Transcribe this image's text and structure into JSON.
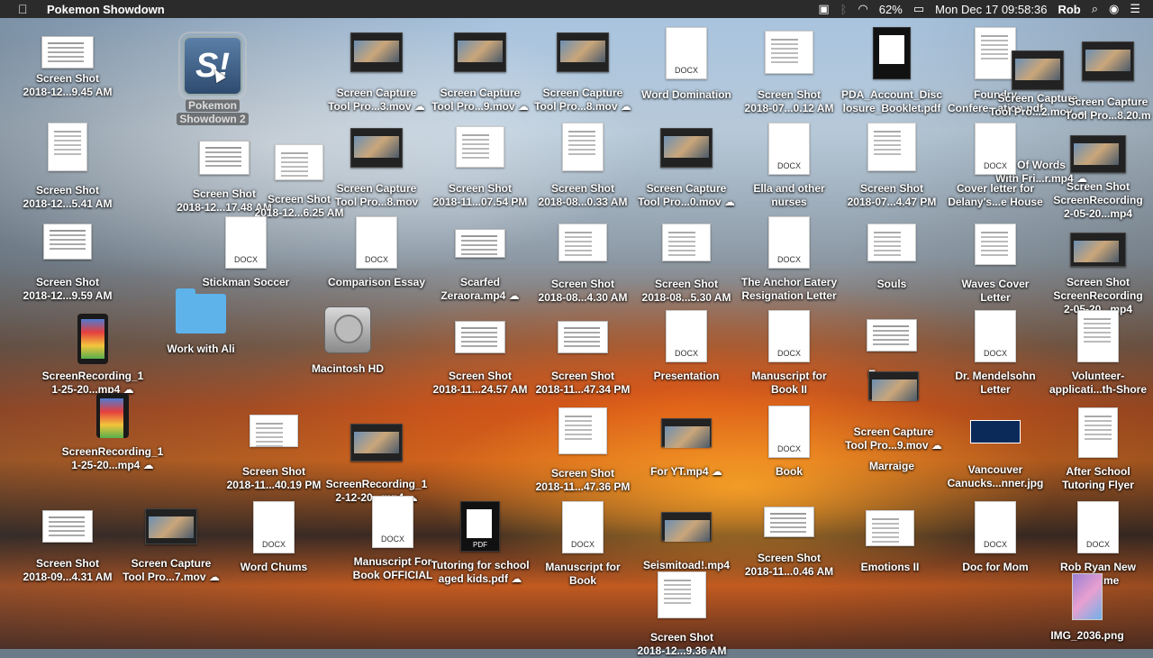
{
  "menubar": {
    "app_name": "Pokemon Showdown",
    "battery": "62%",
    "clock": "Mon Dec 17  09:58:36",
    "user": "Rob"
  },
  "icons": {
    "i01": {
      "line1": "Screen Shot",
      "line2": "2018-12...9.45 AM"
    },
    "i02": {
      "line1": "Pokemon",
      "line2": "Showdown 2"
    },
    "i03": {
      "line1": "Screen Capture",
      "line2": "Tool Pro...3.mov ☁"
    },
    "i04": {
      "line1": "Screen Capture",
      "line2": "Tool Pro...9.mov ☁"
    },
    "i05": {
      "line1": "Screen Capture",
      "line2": "Tool Pro...8.mov ☁"
    },
    "i06": {
      "line1": "Word Domination",
      "line2": ""
    },
    "i07": {
      "line1": "Screen Shot",
      "line2": "2018-07...0.12 AM"
    },
    "i08": {
      "line1": "PDA_Account_Disc",
      "line2": "losure_Booklet.pdf"
    },
    "i09": {
      "line1": "Foundry",
      "line2": "Confere...ation.pdf"
    },
    "i10": {
      "line1": "Screen Capture",
      "line2": "Tool Pro...2.mov ☁"
    },
    "i11": {
      "line1": "Screen Capture",
      "line2": "Tool Pro...8.20.m"
    },
    "i12": {
      "line1": "Screen Shot",
      "line2": "2018-12...5.41 AM"
    },
    "i13": {
      "line1": "Screen Shot",
      "line2": "2018-12...17.48 AM"
    },
    "i14": {
      "line1": "Screen Shot",
      "line2": "2018-12...6.25 AM"
    },
    "i15": {
      "line1": "Screen Capture",
      "line2": "Tool Pro...8.mov"
    },
    "i16": {
      "line1": "Screen Shot",
      "line2": "2018-11...07.54 PM"
    },
    "i17": {
      "line1": "Screen Shot",
      "line2": "2018-08...0.33 AM"
    },
    "i18": {
      "line1": "Screen Capture",
      "line2": "Tool Pro...0.mov ☁"
    },
    "i19": {
      "line1": "Ella and other",
      "line2": "nurses"
    },
    "i20": {
      "line1": "Screen Shot",
      "line2": "2018-07...4.47 PM"
    },
    "i21": {
      "line1": "Of Words",
      "line2": "With Fri...r.mp4 ☁"
    },
    "i22": {
      "line1": "Cover letter for",
      "line2": "Delany's...e House"
    },
    "i23": {
      "line1": "Screen Shot",
      "line2": "ScreenRecording",
      "line3": "2-05-20...mp4"
    },
    "i24": {
      "line1": "Screen Shot",
      "line2": "2018-12...9.59 AM"
    },
    "i25": {
      "line1": "Stickman Soccer",
      "line2": ""
    },
    "i26": {
      "line1": "Comparison Essay",
      "line2": ""
    },
    "i27": {
      "line1": "Scarfed",
      "line2": "Zeraora.mp4 ☁"
    },
    "i28": {
      "line1": "Screen Shot",
      "line2": "2018-08...4.30 AM"
    },
    "i29": {
      "line1": "Screen Shot",
      "line2": "2018-08...5.30 AM"
    },
    "i30": {
      "line1": "The Anchor Eatery",
      "line2": "Resignation Letter"
    },
    "i31": {
      "line1": "Souls",
      "line2": ""
    },
    "i32": {
      "line1": "Waves Cover",
      "line2": "Letter"
    },
    "i33": {
      "line1": "Screen Shot",
      "line2": "ScreenRecording",
      "line3": "2-05-20...mp4"
    },
    "i34": {
      "line1": "ScreenRecording_1",
      "line2": "1-25-20...mp4 ☁"
    },
    "i35": {
      "line1": "Work with Ali",
      "line2": ""
    },
    "i36": {
      "line1": "Macintosh HD",
      "line2": ""
    },
    "i37": {
      "line1": "Screen Shot",
      "line2": "2018-11...24.57 AM"
    },
    "i38": {
      "line1": "Screen Shot",
      "line2": "2018-11...47.34 PM"
    },
    "i39": {
      "line1": "Presentation",
      "line2": ""
    },
    "i40": {
      "line1": "Manuscript for",
      "line2": "Book II"
    },
    "i41": {
      "line1": "E",
      "line2": ""
    },
    "i42": {
      "line1": "Dr. Mendelsohn",
      "line2": "Letter"
    },
    "i43": {
      "line1": "Volunteer-",
      "line2": "applicati...th-Shore"
    },
    "i44": {
      "line1": "ScreenRecording_1",
      "line2": "1-25-20...mp4 ☁"
    },
    "i45": {
      "line1": "Screen Shot",
      "line2": "2018-11...40.19 PM"
    },
    "i46": {
      "line1": "ScreenRecording_1",
      "line2": "2-12-20...mp4 ☁"
    },
    "i47": {
      "line1": "Screen Shot",
      "line2": "2018-11...47.36 PM"
    },
    "i48": {
      "line1": "For YT.mp4 ☁",
      "line2": ""
    },
    "i49": {
      "line1": "Book",
      "line2": ""
    },
    "i50": {
      "line1": "Screen Capture",
      "line2": "Tool Pro...9.mov ☁"
    },
    "i51": {
      "line1": "Marraige",
      "line2": ""
    },
    "i52": {
      "line1": "Vancouver",
      "line2": "Canucks...nner.jpg"
    },
    "i53": {
      "line1": "After School",
      "line2": "Tutoring Flyer"
    },
    "i54": {
      "line1": "Screen Shot",
      "line2": "2018-09...4.31 AM"
    },
    "i55": {
      "line1": "Screen Capture",
      "line2": "Tool Pro...7.mov ☁"
    },
    "i56": {
      "line1": "Word Chums",
      "line2": ""
    },
    "i57": {
      "line1": "Manuscript For",
      "line2": "Book OFFICIAL"
    },
    "i58": {
      "line1": "Tutoring for school",
      "line2": "aged kids.pdf ☁"
    },
    "i59": {
      "line1": "Manuscript for",
      "line2": "Book"
    },
    "i60": {
      "line1": "Seismitoad!.mp4",
      "line2": ""
    },
    "i61": {
      "line1": "Screen Shot",
      "line2": "2018-11...0.46 AM"
    },
    "i62": {
      "line1": "Emotions II",
      "line2": ""
    },
    "i63": {
      "line1": "Doc for Mom",
      "line2": ""
    },
    "i64": {
      "line1": "Rob Ryan New",
      "line2": "Resume"
    },
    "i65": {
      "line1": "Screen Shot",
      "line2": "2018-12...9.36 AM"
    },
    "i66": {
      "line1": "IMG_2036.png",
      "line2": ""
    }
  },
  "docx_tag": "DOCX",
  "pdf_tag": "PDF",
  "app_glyph": "S!"
}
